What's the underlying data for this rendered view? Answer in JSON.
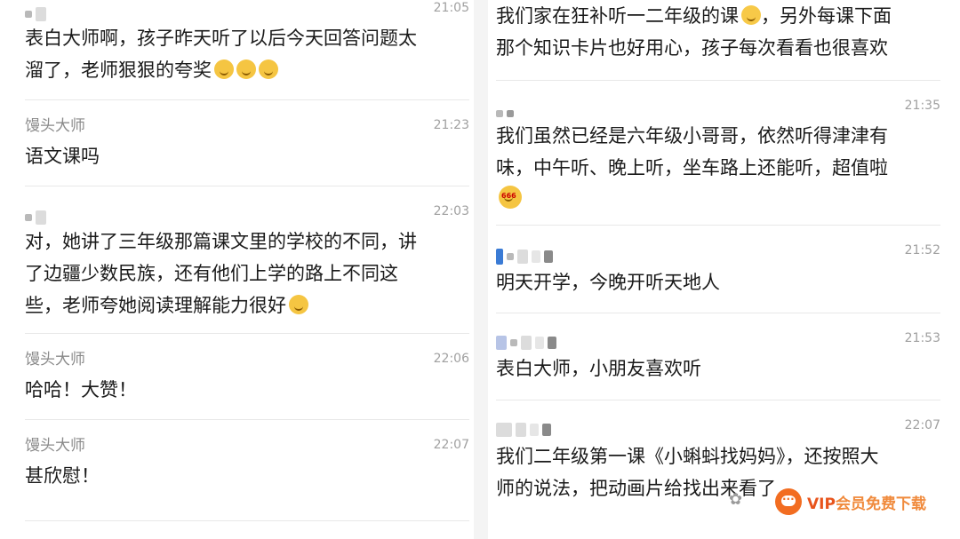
{
  "left": {
    "entries": [
      {
        "nick": "",
        "time": "21:05",
        "lines": [
          "表白大师啊，孩子昨天听了以后今天回答问题太",
          "溜了，老师狠狠的夸奖"
        ],
        "emoji_count": 3
      },
      {
        "nick": "馒头大师",
        "time": "21:23",
        "lines": [
          "语文课吗"
        ]
      },
      {
        "nick": "",
        "time": "22:03",
        "lines": [
          "对，她讲了三年级那篇课文里的学校的不同，讲",
          "了边疆少数民族，还有他们上学的路上不同这",
          "些，老师夸她阅读理解能力很好"
        ],
        "emoji_count": 1
      },
      {
        "nick": "馒头大师",
        "time": "22:06",
        "lines": [
          "哈哈！大赞！"
        ]
      },
      {
        "nick": "馒头大师",
        "time": "22:07",
        "lines": [
          "甚欣慰！"
        ]
      }
    ]
  },
  "right": {
    "entries": [
      {
        "lines": [
          "我们家在狂补听一二年级的课",
          "，另外每课下面",
          "那个知识卡片也好用心，孩子每次看看也很喜欢"
        ]
      },
      {
        "time": "21:35",
        "lines": [
          "我们虽然已经是六年级小哥哥，依然听得津津有",
          "味，中午听、晚上听，坐车路上还能听，超值啦"
        ],
        "emoji_text": "666"
      },
      {
        "time": "21:52",
        "lines": [
          "明天开学，今晚开听天地人"
        ]
      },
      {
        "time": "21:53",
        "lines": [
          "表白大师，小朋友喜欢听"
        ]
      },
      {
        "time": "22:07",
        "lines": [
          "我们二年级第一课《小蝌蚪找妈妈》，还按照大",
          "师的说法，把动画片给找出来看了"
        ]
      }
    ]
  },
  "watermark": {
    "vip": "VIP",
    "rest": "会员免费下载",
    "icon": "chat-bubble-icon"
  },
  "colors": {
    "background": "#ffffff",
    "timestamp": "#a0a0a0",
    "nickname": "#8a8a8a",
    "watermark": "#e8541c"
  }
}
